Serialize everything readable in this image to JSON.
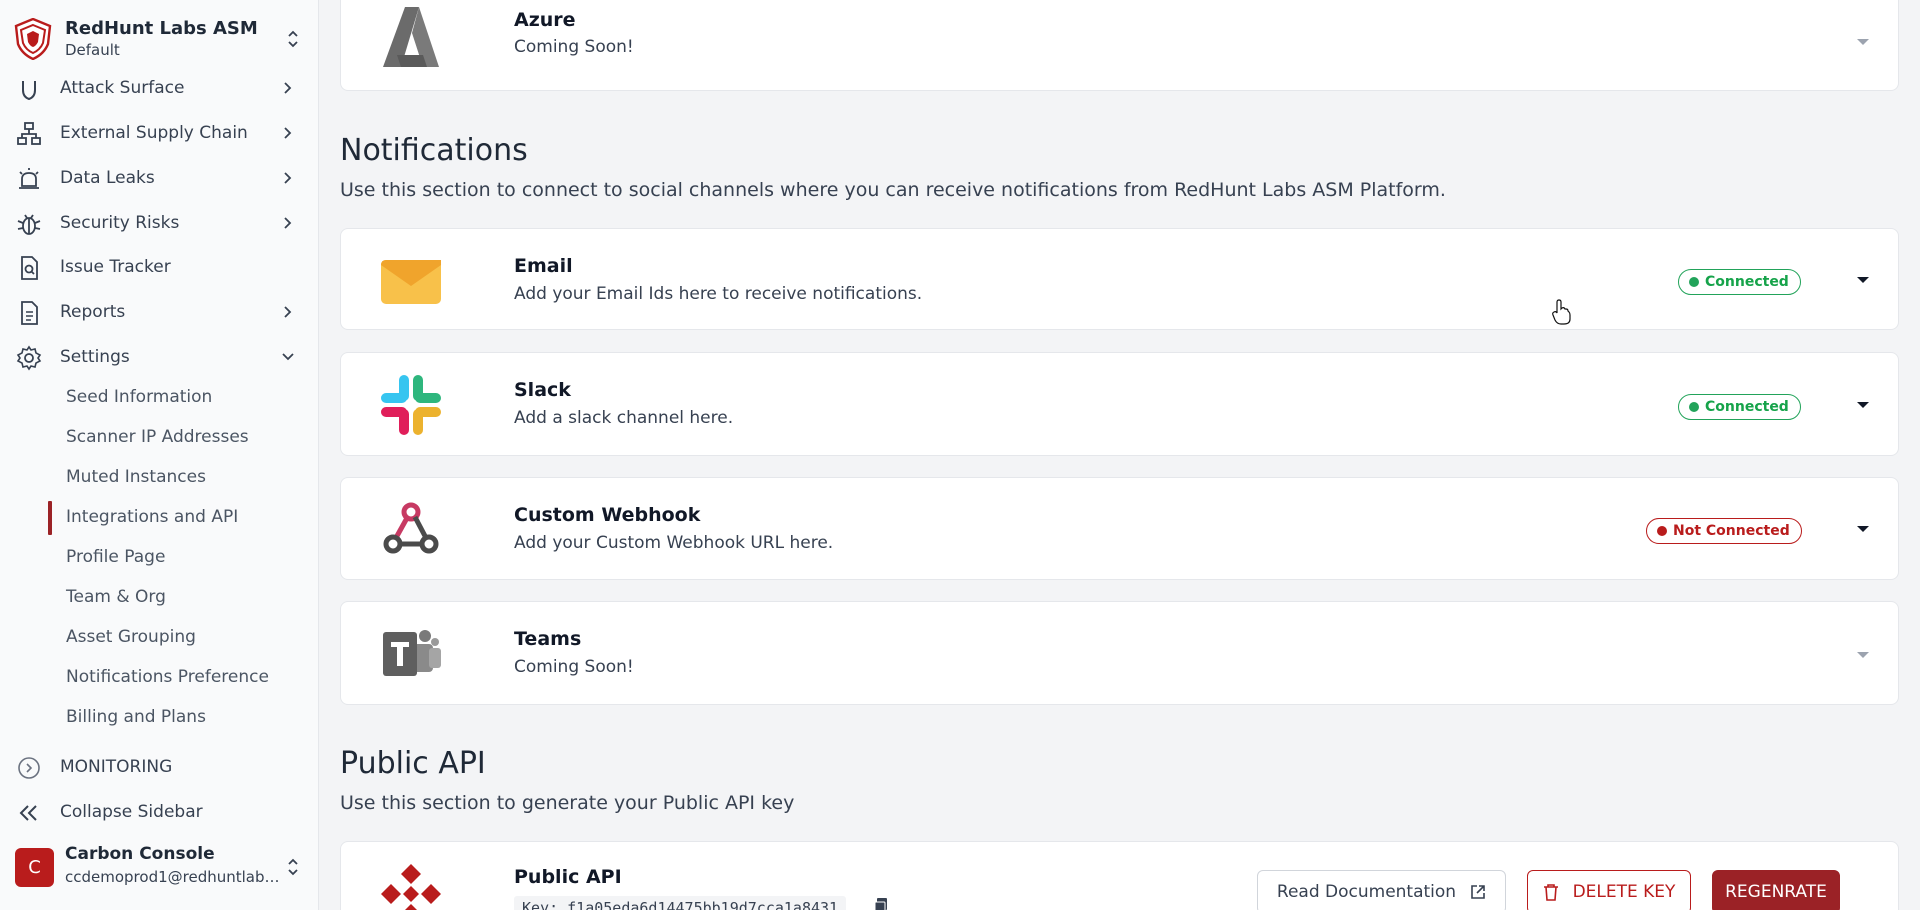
{
  "sidebar": {
    "brand_name": "RedHunt Labs ASM",
    "brand_sub": "Default",
    "items": [
      {
        "label": "Attack Surface"
      },
      {
        "label": "External Supply Chain"
      },
      {
        "label": "Data Leaks"
      },
      {
        "label": "Security Risks"
      },
      {
        "label": "Issue Tracker"
      },
      {
        "label": "Reports"
      },
      {
        "label": "Settings"
      }
    ],
    "settings_items": [
      {
        "label": "Seed Information"
      },
      {
        "label": "Scanner IP Addresses"
      },
      {
        "label": "Muted Instances"
      },
      {
        "label": "Integrations and API"
      },
      {
        "label": "Profile Page"
      },
      {
        "label": "Team & Org"
      },
      {
        "label": "Asset Grouping"
      },
      {
        "label": "Notifications Preference"
      },
      {
        "label": "Billing and Plans"
      }
    ],
    "monitoring_label": "MONITORING",
    "collapse_label": "Collapse Sidebar",
    "user": {
      "initial": "C",
      "name": "Carbon Console",
      "email": "ccdemoprod1@redhuntlabs..."
    }
  },
  "integrations": {
    "azure": {
      "title": "Azure",
      "desc": "Coming Soon!"
    }
  },
  "notifications": {
    "title": "Notifications",
    "desc": "Use this section to connect to social channels where you can receive notifications from RedHunt Labs ASM Platform.",
    "items": [
      {
        "title": "Email",
        "desc": "Add your Email Ids here to receive notifications.",
        "status": "Connected"
      },
      {
        "title": "Slack",
        "desc": "Add a slack channel here.",
        "status": "Connected"
      },
      {
        "title": "Custom Webhook",
        "desc": "Add your Custom Webhook URL here.",
        "status": "Not Connected"
      },
      {
        "title": "Teams",
        "desc": "Coming Soon!",
        "status": ""
      }
    ]
  },
  "public_api": {
    "title": "Public API",
    "desc": "Use this section to generate your Public API key",
    "card_title": "Public API",
    "key_text": "Key: f1a05eda6d14475bb19d7cca1a8431",
    "read_docs_label": "Read Documentation",
    "delete_label": "DELETE KEY",
    "regenerate_label": "REGENRATE"
  },
  "colors": {
    "accent": "#9b2226",
    "connected": "#22a35a",
    "not_connected": "#b91c1c"
  },
  "icons": [
    "shield-logo-icon",
    "updown-chevron-icon",
    "shield-icon",
    "network-icon",
    "alarm-icon",
    "bug-icon",
    "file-search-icon",
    "document-icon",
    "gear-icon",
    "chevron-right-icon",
    "chevron-down-icon",
    "monitoring-icon",
    "collapse-icon",
    "caret-down-icon",
    "external-link-icon",
    "trash-icon",
    "copy-icon",
    "cursor-hand-icon"
  ]
}
